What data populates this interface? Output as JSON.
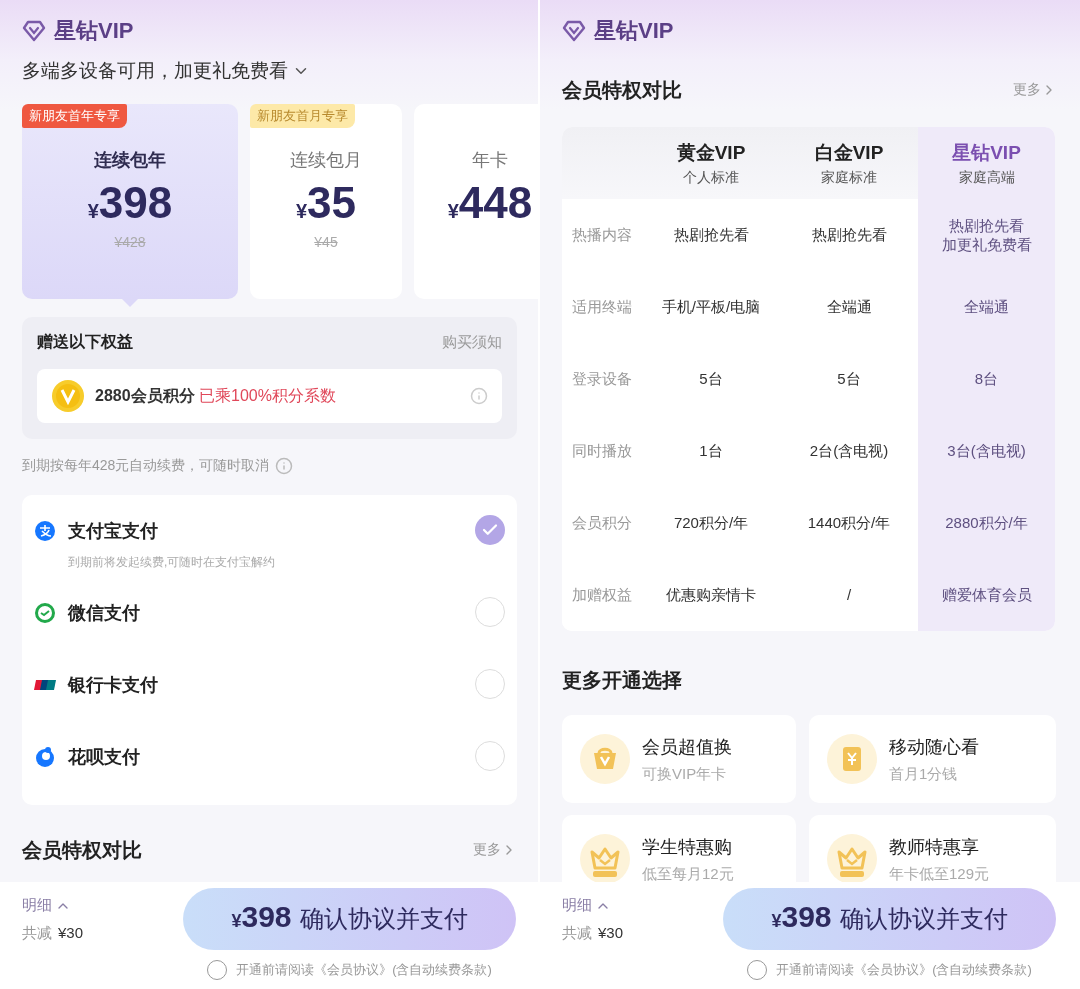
{
  "left_screen": {
    "brand": "星钻VIP",
    "tagline": "多端多设备可用，加更礼免费看",
    "plans": [
      {
        "badge": {
          "text": "新朋友首年专享",
          "color": "#ef5840"
        },
        "name": "连续包年",
        "currency": "¥",
        "price": "398",
        "original_price": "¥428",
        "selected": true
      },
      {
        "badge": {
          "text": "新朋友首月专享",
          "color": "#fde9a8"
        },
        "name": "连续包月",
        "currency": "¥",
        "price": "35",
        "original_price": "¥45",
        "selected": false
      },
      {
        "name": "年卡",
        "currency": "¥",
        "price": "448",
        "selected": false
      }
    ],
    "benefits": {
      "title": "赠送以下权益",
      "link": "购买须知",
      "points": "2880会员积分",
      "points_note": "已乘100%积分系数"
    },
    "renewal_note": "到期按每年428元自动续费，可随时取消",
    "payment_methods": [
      {
        "kind": "alipay",
        "name": "支付宝支付",
        "note": "到期前将发起续费,可随时在支付宝解约",
        "selected": true
      },
      {
        "kind": "wechat",
        "name": "微信支付",
        "selected": false
      },
      {
        "kind": "unionpay",
        "name": "银行卡支付",
        "selected": false
      },
      {
        "kind": "huabei",
        "name": "花呗支付",
        "selected": false
      }
    ],
    "comparison_heading": {
      "title": "会员特权对比",
      "more": "更多"
    },
    "bottom_bar": {
      "details": "明细",
      "discount_label": "共减",
      "discount": "¥30",
      "pay_button": {
        "currency": "¥",
        "amount": "398",
        "label": "确认协议并支付"
      },
      "agreement": {
        "text": "开通前请阅读《会员协议》(含自动续费条款)",
        "checked": false
      }
    }
  },
  "right_screen": {
    "brand": "星钻VIP",
    "comparison": {
      "title": "会员特权对比",
      "more": "更多",
      "tiers": [
        {
          "name": "黄金VIP",
          "subtitle": "个人标准",
          "highlighted": false
        },
        {
          "name": "白金VIP",
          "subtitle": "家庭标准",
          "highlighted": false
        },
        {
          "name": "星钻VIP",
          "subtitle": "家庭高端",
          "highlighted": true
        }
      ],
      "rows": [
        {
          "label": "热播内容",
          "values": [
            [
              "热剧抢先看"
            ],
            [
              "热剧抢先看"
            ],
            [
              "热剧抢先看",
              "加更礼免费看"
            ]
          ]
        },
        {
          "label": "适用终端",
          "values": [
            [
              "手机/平板/电脑"
            ],
            [
              "全端通"
            ],
            [
              "全端通"
            ]
          ]
        },
        {
          "label": "登录设备",
          "values": [
            [
              "5台"
            ],
            [
              "5台"
            ],
            [
              "8台"
            ]
          ]
        },
        {
          "label": "同时播放",
          "values": [
            [
              "1台"
            ],
            [
              "2台(含电视)"
            ],
            [
              "3台(含电视)"
            ]
          ]
        },
        {
          "label": "会员积分",
          "values": [
            [
              "720积分/年"
            ],
            [
              "1440积分/年"
            ],
            [
              "2880积分/年"
            ]
          ]
        },
        {
          "label": "加赠权益",
          "values": [
            [
              "优惠购亲情卡"
            ],
            [
              "/"
            ],
            [
              "赠爱体育会员"
            ]
          ]
        }
      ]
    },
    "more_options": {
      "title": "更多开通选择",
      "items": [
        {
          "kind": "bag",
          "title": "会员超值换",
          "subtitle": "可换VIP年卡"
        },
        {
          "kind": "yen",
          "title": "移动随心看",
          "subtitle": "首月1分钱"
        },
        {
          "kind": "crown",
          "title": "学生特惠购",
          "subtitle": "低至每月12元"
        },
        {
          "kind": "crown",
          "title": "教师特惠享",
          "subtitle": "年卡低至129元"
        }
      ]
    },
    "bottom_bar": {
      "details": "明细",
      "discount_label": "共减",
      "discount": "¥30",
      "pay_button": {
        "currency": "¥",
        "amount": "398",
        "label": "确认协议并支付"
      },
      "agreement": {
        "text": "开通前请阅读《会员协议》(含自动续费条款)",
        "checked": false
      }
    }
  }
}
